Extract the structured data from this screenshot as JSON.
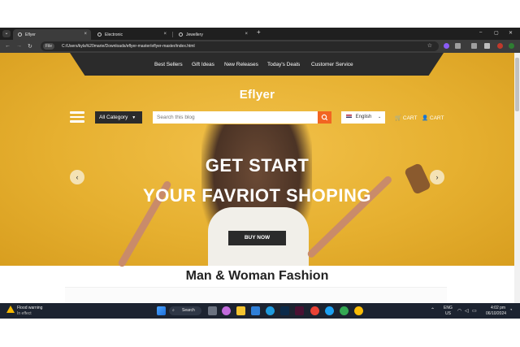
{
  "browser": {
    "tabs": [
      {
        "title": "Eflyer"
      },
      {
        "title": "Electronic"
      },
      {
        "title": "Jewellery"
      }
    ],
    "new_tab": "+",
    "close": "×",
    "window_controls": {
      "minimize": "–",
      "maximize": "▢",
      "close": "✕"
    },
    "nav": {
      "back": "←",
      "forward": "→",
      "reload": "↻"
    },
    "address": {
      "chip": "File",
      "url": "C:/Users/kyla%20marie/Downloads/eflyer-master/eflyer-master/index.html"
    }
  },
  "site": {
    "nav_links": [
      "Best Sellers",
      "Gift Ideas",
      "New Releases",
      "Today's Deals",
      "Customer Service"
    ],
    "brand": "Eflyer",
    "category_button": "All Category",
    "search_placeholder": "Search this blog",
    "language": "English",
    "cart_1": "CART",
    "cart_2": "CART",
    "hero": {
      "line1": "GET START",
      "line2": "YOUR FAVRIOT SHOPING",
      "cta": "BUY NOW",
      "prev": "‹",
      "next": "›"
    },
    "section_title": "Man & Woman Fashion"
  },
  "taskbar": {
    "weather_title": "Flood warning",
    "weather_sub": "In effect",
    "search_label": "Search",
    "lang_top": "ENG",
    "lang_bottom": "US",
    "time": "4:02 pm",
    "date": "06/10/2024"
  },
  "colors": {
    "hero_yellow": "#e6b030",
    "dark_bar": "#2b2b2b",
    "search_button": "#f26522"
  }
}
